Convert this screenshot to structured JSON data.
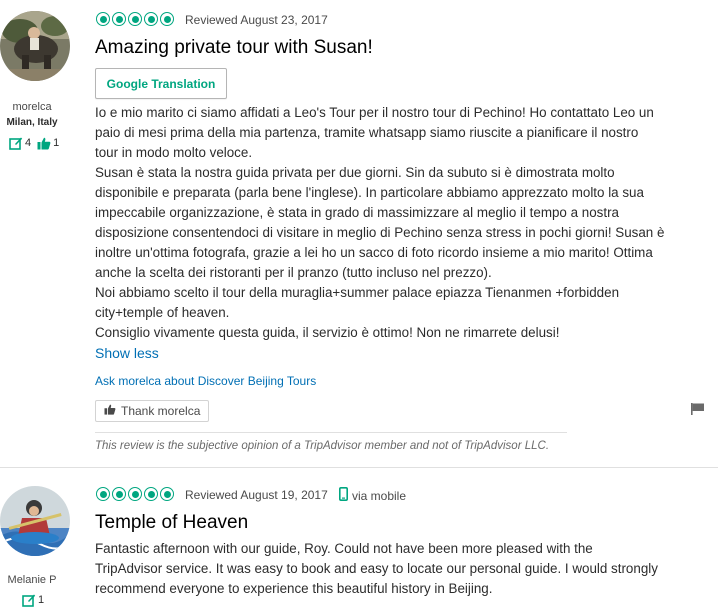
{
  "reviews": [
    {
      "user": {
        "name": "morelca",
        "location": "Milan, Italy",
        "contributions": "4",
        "helpful_votes": "1"
      },
      "rating": 5,
      "date": "Reviewed August 23, 2017",
      "title": "Amazing private tour with Susan!",
      "translate_button": "Google Translation",
      "paragraphs": [
        "Io e mio marito ci siamo affidati a Leo's Tour per il nostro tour di Pechino! Ho contattato Leo un paio di mesi prima della mia partenza, tramite whatsapp siamo riuscite a pianificare il nostro tour in modo molto veloce.",
        "Susan è stata la nostra guida privata per due giorni. Sin da subuto si è dimostrata molto disponibile e preparata (parla bene l'inglese). In particolare abbiamo apprezzato molto la sua impeccabile organizzazione, è stata in grado di massimizzare al meglio il tempo a nostra disposizione consentendoci di visitare in meglio di Pechino senza stress in pochi giorni! Susan è inoltre un'ottima fotografa, grazie a lei ho un sacco di foto ricordo insieme a mio marito! Ottima anche la scelta dei ristoranti per il pranzo (tutto incluso nel prezzo).",
        "Noi abbiamo scelto il tour della muraglia+summer palace epiazza Tienanmen +forbidden city+temple of heaven.",
        "Consiglio vivamente questa guida, il servizio è ottimo! Non ne rimarrete delusi!"
      ],
      "show_less": "Show less",
      "ask_link": "Ask morelca about Discover Beijing Tours",
      "thank_button": "Thank morelca",
      "disclaimer": "This review is the subjective opinion of a TripAdvisor member and not of TripAdvisor LLC."
    },
    {
      "user": {
        "name": "Melanie P",
        "contributions": "1"
      },
      "rating": 5,
      "date": "Reviewed August 19, 2017",
      "via": "via mobile",
      "title": "Temple of Heaven",
      "text": "Fantastic afternoon with our guide, Roy. Could not have been more pleased with the TripAdvisor service. It was easy to book and easy to locate our personal guide. I would strongly recommend everyone to experience this beautiful history in Beijing."
    }
  ],
  "colors": {
    "bubble_green": "#00a680",
    "link_blue": "#006fb4",
    "text": "#2c2c2c"
  },
  "icons": {
    "contribution": "review-pencil-icon",
    "helpful": "thumbs-up-icon",
    "mobile": "mobile-phone-icon",
    "flag": "report-flag-icon"
  }
}
